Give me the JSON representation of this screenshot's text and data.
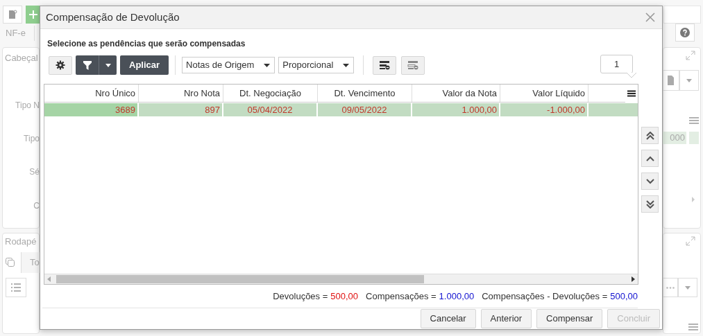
{
  "background": {
    "tab": "NF-e",
    "header_panel_title": "Cabeçal",
    "field_labels": [
      "Tipo N",
      "Tipo",
      "Sé",
      "C"
    ],
    "grid_cell": "000",
    "footer_panel_title": "Rodapé",
    "footer_tab": "To"
  },
  "dialog": {
    "title": "Compensação de Devolução",
    "subtitle": "Selecione as pendências que serão compensadas",
    "toolbar": {
      "apply_button": "Aplicar",
      "dropdowns": [
        {
          "value": "Notas de Origem"
        },
        {
          "value": "Proporcional"
        }
      ],
      "page_indicator": "1"
    },
    "table": {
      "columns": [
        "Nro Único",
        "Nro Nota",
        "Dt. Negociação",
        "Dt. Vencimento",
        "Valor da Nota",
        "Valor Líquido"
      ],
      "rows": [
        {
          "selected": true,
          "cells": [
            "3689",
            "897",
            "05/04/2022",
            "09/05/2022",
            "1.000,00",
            "-1.000,00"
          ]
        }
      ]
    },
    "totals": [
      {
        "label": "Devoluções =",
        "value": "500,00",
        "color": "#e01010"
      },
      {
        "label": "Compensações =",
        "value": "1.000,00",
        "color": "#1010d0"
      },
      {
        "label": "Compensações - Devoluções =",
        "value": "500,00",
        "color": "#1010d0"
      }
    ],
    "buttons": [
      {
        "label": "Cancelar",
        "disabled": false
      },
      {
        "label": "Anterior",
        "disabled": false
      },
      {
        "label": "Compensar",
        "disabled": false
      },
      {
        "label": "Concluir",
        "disabled": true
      }
    ]
  }
}
